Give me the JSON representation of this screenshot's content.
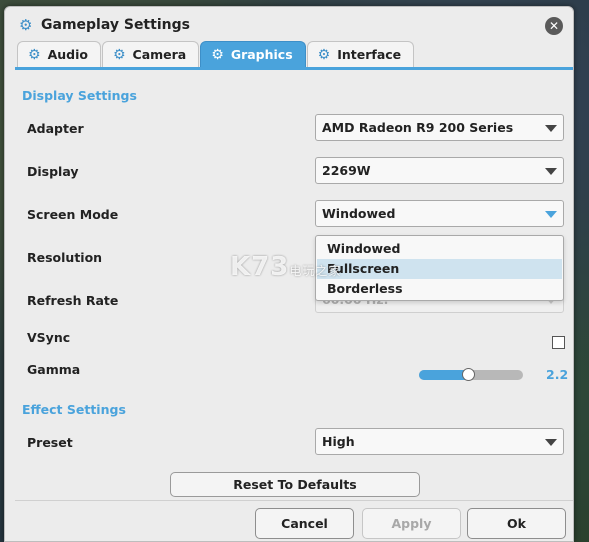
{
  "window": {
    "title": "Gameplay Settings",
    "title_icon": "gear-icon",
    "close_icon": "close-icon"
  },
  "tabs": [
    {
      "label": "Audio",
      "icon": "gear-icon",
      "active": false
    },
    {
      "label": "Camera",
      "icon": "gear-icon",
      "active": false
    },
    {
      "label": "Graphics",
      "icon": "gear-icon",
      "active": true
    },
    {
      "label": "Interface",
      "icon": "gear-icon",
      "active": false
    }
  ],
  "display_settings": {
    "heading": "Display Settings",
    "adapter": {
      "label": "Adapter",
      "value": "AMD Radeon R9 200 Series"
    },
    "display": {
      "label": "Display",
      "value": "2269W"
    },
    "screen_mode": {
      "label": "Screen Mode",
      "value": "Windowed",
      "options": [
        "Windowed",
        "Fullscreen",
        "Borderless"
      ],
      "highlighted": "Fullscreen"
    },
    "resolution": {
      "label": "Resolution"
    },
    "refresh_rate": {
      "label": "Refresh Rate",
      "value": "60.00 Hz."
    },
    "vsync": {
      "label": "VSync",
      "checked": false
    },
    "gamma": {
      "label": "Gamma",
      "value": "2.2",
      "fraction": 0.47
    }
  },
  "effect_settings": {
    "heading": "Effect Settings",
    "preset": {
      "label": "Preset",
      "value": "High"
    }
  },
  "buttons": {
    "reset": "Reset To Defaults",
    "cancel": "Cancel",
    "apply": "Apply",
    "ok": "Ok"
  },
  "watermark": {
    "text": "K73",
    "subtext": "电玩之家"
  },
  "colors": {
    "accent": "#4aa3dc",
    "window_bg": "#ececec"
  }
}
